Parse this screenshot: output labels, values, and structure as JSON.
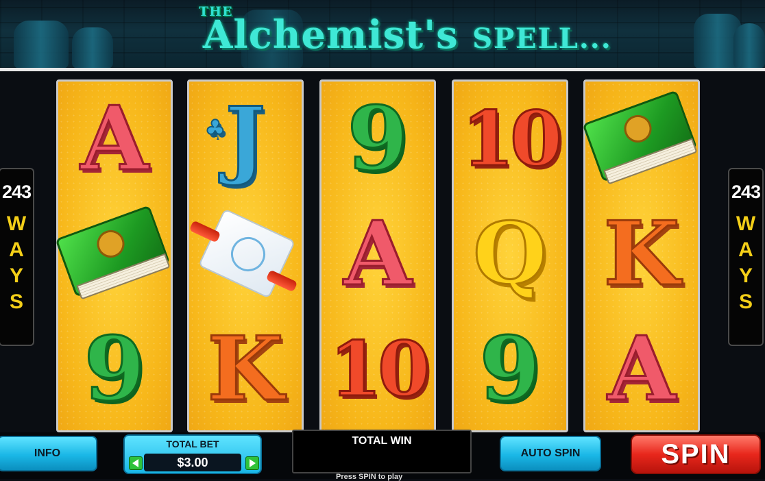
{
  "header": {
    "title_prefix": "THE",
    "title_main": "Alchemist's",
    "title_sub": "SPELL..."
  },
  "ways_left": {
    "number": "243",
    "word": [
      "W",
      "A",
      "Y",
      "S"
    ]
  },
  "ways_right": {
    "number": "243",
    "word": [
      "W",
      "A",
      "Y",
      "S"
    ]
  },
  "reels": [
    [
      "A",
      "book",
      "9"
    ],
    [
      "J",
      "scroll",
      "K"
    ],
    [
      "9",
      "A",
      "10"
    ],
    [
      "10",
      "Q",
      "9"
    ],
    [
      "book",
      "K",
      "A"
    ]
  ],
  "controls": {
    "info_label": "INFO",
    "total_bet_label": "TOTAL BET",
    "total_bet_value": "$3.00",
    "total_win_label": "TOTAL WIN",
    "auto_spin_label": "AUTO SPIN",
    "spin_label": "SPIN",
    "press_hint": "Press SPIN to play"
  },
  "colors": {
    "reel_bg": "#f7b71a",
    "title": "#3fe8d6",
    "ways_text": "#f4cf18",
    "spin_button": "#e8271c",
    "control_buttons": "#1ab7e6"
  }
}
